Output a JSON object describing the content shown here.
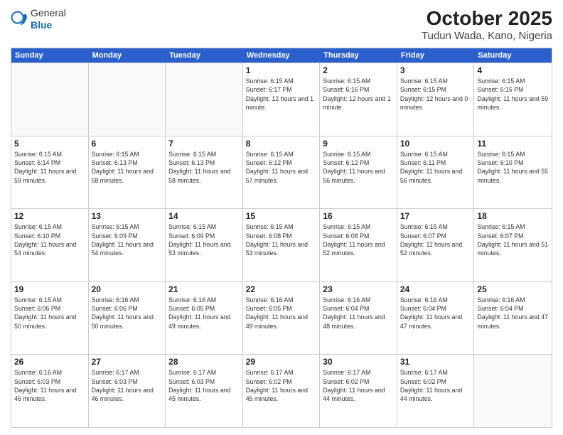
{
  "header": {
    "logo_general": "General",
    "logo_blue": "Blue",
    "title": "October 2025",
    "subtitle": "Tudun Wada, Kano, Nigeria"
  },
  "calendar": {
    "days_of_week": [
      "Sunday",
      "Monday",
      "Tuesday",
      "Wednesday",
      "Thursday",
      "Friday",
      "Saturday"
    ],
    "rows": [
      [
        {
          "day": "",
          "empty": true
        },
        {
          "day": "",
          "empty": true
        },
        {
          "day": "",
          "empty": true
        },
        {
          "day": "1",
          "sunrise": "6:15 AM",
          "sunset": "6:17 PM",
          "daylight": "12 hours and 1 minute."
        },
        {
          "day": "2",
          "sunrise": "6:15 AM",
          "sunset": "6:16 PM",
          "daylight": "12 hours and 1 minute."
        },
        {
          "day": "3",
          "sunrise": "6:15 AM",
          "sunset": "6:15 PM",
          "daylight": "12 hours and 0 minutes."
        },
        {
          "day": "4",
          "sunrise": "6:15 AM",
          "sunset": "6:15 PM",
          "daylight": "11 hours and 59 minutes."
        }
      ],
      [
        {
          "day": "5",
          "sunrise": "6:15 AM",
          "sunset": "6:14 PM",
          "daylight": "11 hours and 59 minutes."
        },
        {
          "day": "6",
          "sunrise": "6:15 AM",
          "sunset": "6:13 PM",
          "daylight": "11 hours and 58 minutes."
        },
        {
          "day": "7",
          "sunrise": "6:15 AM",
          "sunset": "6:13 PM",
          "daylight": "11 hours and 58 minutes."
        },
        {
          "day": "8",
          "sunrise": "6:15 AM",
          "sunset": "6:12 PM",
          "daylight": "11 hours and 57 minutes."
        },
        {
          "day": "9",
          "sunrise": "6:15 AM",
          "sunset": "6:12 PM",
          "daylight": "11 hours and 56 minutes."
        },
        {
          "day": "10",
          "sunrise": "6:15 AM",
          "sunset": "6:11 PM",
          "daylight": "11 hours and 56 minutes."
        },
        {
          "day": "11",
          "sunrise": "6:15 AM",
          "sunset": "6:10 PM",
          "daylight": "11 hours and 55 minutes."
        }
      ],
      [
        {
          "day": "12",
          "sunrise": "6:15 AM",
          "sunset": "6:10 PM",
          "daylight": "11 hours and 54 minutes."
        },
        {
          "day": "13",
          "sunrise": "6:15 AM",
          "sunset": "6:09 PM",
          "daylight": "11 hours and 54 minutes."
        },
        {
          "day": "14",
          "sunrise": "6:15 AM",
          "sunset": "6:09 PM",
          "daylight": "11 hours and 53 minutes."
        },
        {
          "day": "15",
          "sunrise": "6:15 AM",
          "sunset": "6:08 PM",
          "daylight": "11 hours and 53 minutes."
        },
        {
          "day": "16",
          "sunrise": "6:15 AM",
          "sunset": "6:08 PM",
          "daylight": "11 hours and 52 minutes."
        },
        {
          "day": "17",
          "sunrise": "6:15 AM",
          "sunset": "6:07 PM",
          "daylight": "11 hours and 52 minutes."
        },
        {
          "day": "18",
          "sunrise": "6:15 AM",
          "sunset": "6:07 PM",
          "daylight": "11 hours and 51 minutes."
        }
      ],
      [
        {
          "day": "19",
          "sunrise": "6:15 AM",
          "sunset": "6:06 PM",
          "daylight": "11 hours and 50 minutes."
        },
        {
          "day": "20",
          "sunrise": "6:16 AM",
          "sunset": "6:06 PM",
          "daylight": "11 hours and 50 minutes."
        },
        {
          "day": "21",
          "sunrise": "6:16 AM",
          "sunset": "6:05 PM",
          "daylight": "11 hours and 49 minutes."
        },
        {
          "day": "22",
          "sunrise": "6:16 AM",
          "sunset": "6:05 PM",
          "daylight": "11 hours and 49 minutes."
        },
        {
          "day": "23",
          "sunrise": "6:16 AM",
          "sunset": "6:04 PM",
          "daylight": "11 hours and 48 minutes."
        },
        {
          "day": "24",
          "sunrise": "6:16 AM",
          "sunset": "6:04 PM",
          "daylight": "11 hours and 47 minutes."
        },
        {
          "day": "25",
          "sunrise": "6:16 AM",
          "sunset": "6:04 PM",
          "daylight": "11 hours and 47 minutes."
        }
      ],
      [
        {
          "day": "26",
          "sunrise": "6:16 AM",
          "sunset": "6:03 PM",
          "daylight": "11 hours and 46 minutes."
        },
        {
          "day": "27",
          "sunrise": "6:17 AM",
          "sunset": "6:03 PM",
          "daylight": "11 hours and 46 minutes."
        },
        {
          "day": "28",
          "sunrise": "6:17 AM",
          "sunset": "6:03 PM",
          "daylight": "11 hours and 45 minutes."
        },
        {
          "day": "29",
          "sunrise": "6:17 AM",
          "sunset": "6:02 PM",
          "daylight": "11 hours and 45 minutes."
        },
        {
          "day": "30",
          "sunrise": "6:17 AM",
          "sunset": "6:02 PM",
          "daylight": "11 hours and 44 minutes."
        },
        {
          "day": "31",
          "sunrise": "6:17 AM",
          "sunset": "6:02 PM",
          "daylight": "11 hours and 44 minutes."
        },
        {
          "day": "",
          "empty": true
        }
      ]
    ]
  }
}
